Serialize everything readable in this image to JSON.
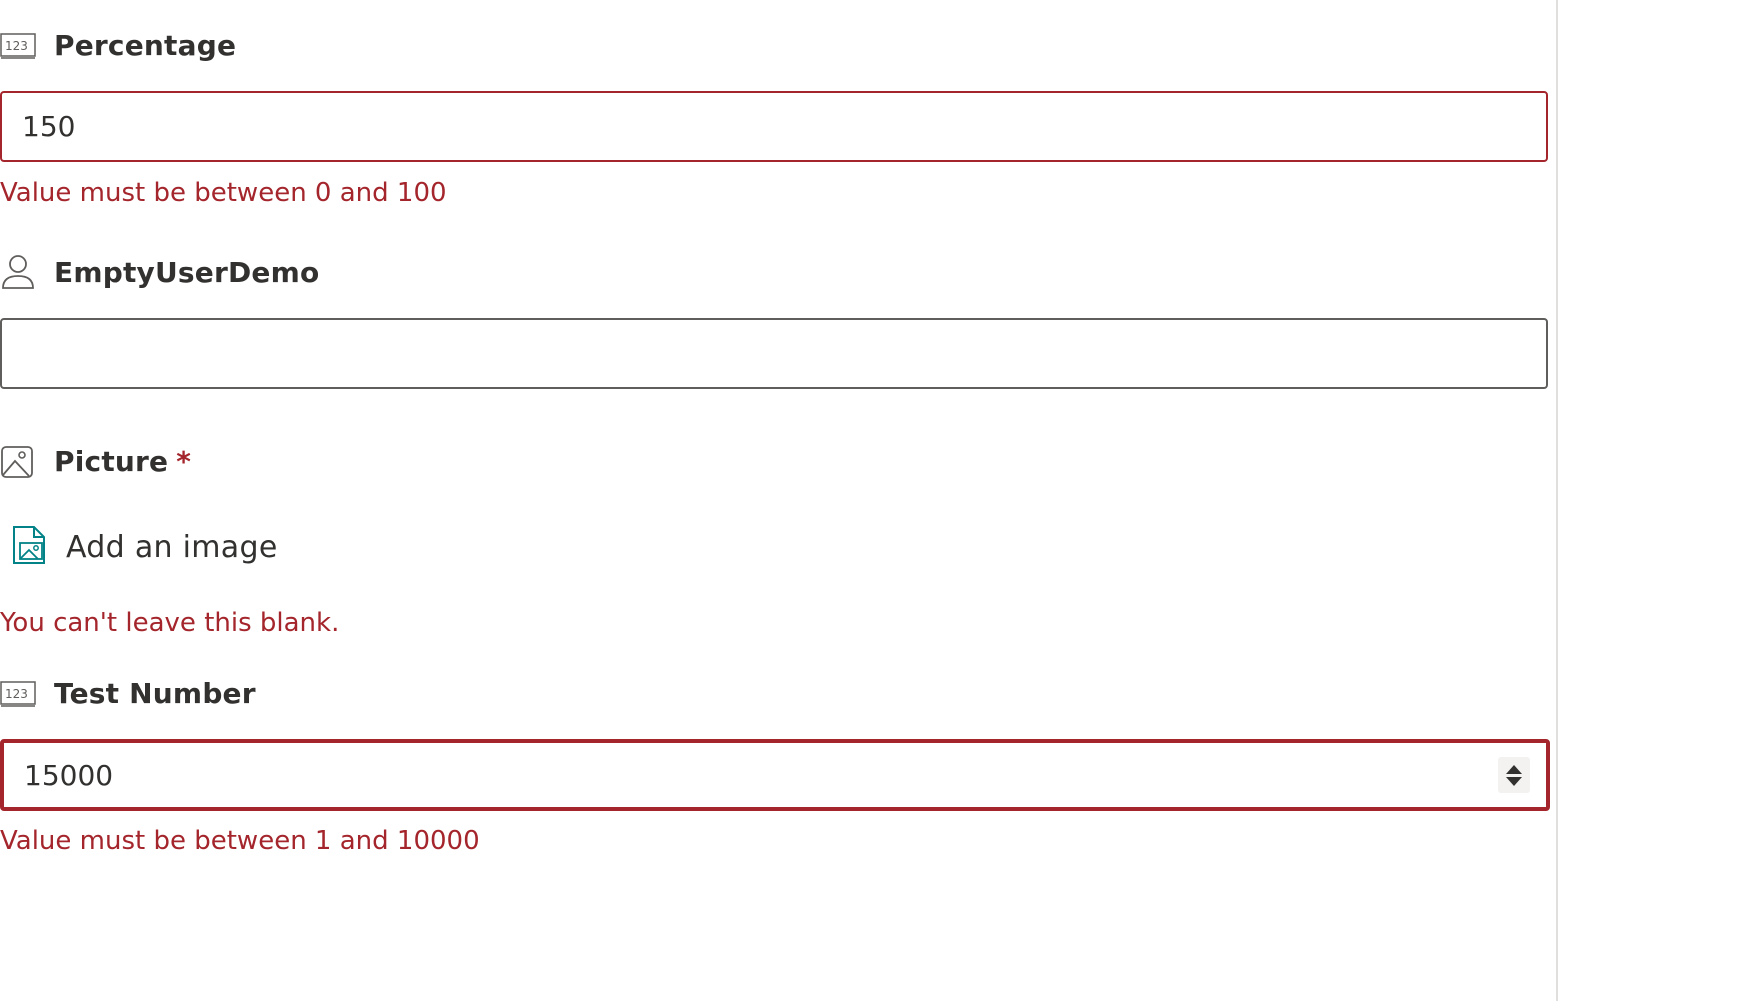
{
  "colors": {
    "error": "#a4262c",
    "text": "#323130",
    "border": "#605e5c",
    "accent_icon": "#038387"
  },
  "fields": {
    "percentage": {
      "icon": "number-icon",
      "icon_text": "123",
      "label": "Percentage",
      "value": "150",
      "error": "Value must be between 0 and 100"
    },
    "empty_user": {
      "icon": "person-icon",
      "label": "EmptyUserDemo",
      "value": ""
    },
    "picture": {
      "icon": "image-icon",
      "label": "Picture",
      "required_marker": "*",
      "add_icon": "add-image-icon",
      "add_label": "Add an image",
      "error": "You can't leave this blank."
    },
    "test_number": {
      "icon": "number-icon",
      "icon_text": "123",
      "label": "Test Number",
      "value": "15000",
      "error": "Value must be between 1 and 10000"
    }
  }
}
